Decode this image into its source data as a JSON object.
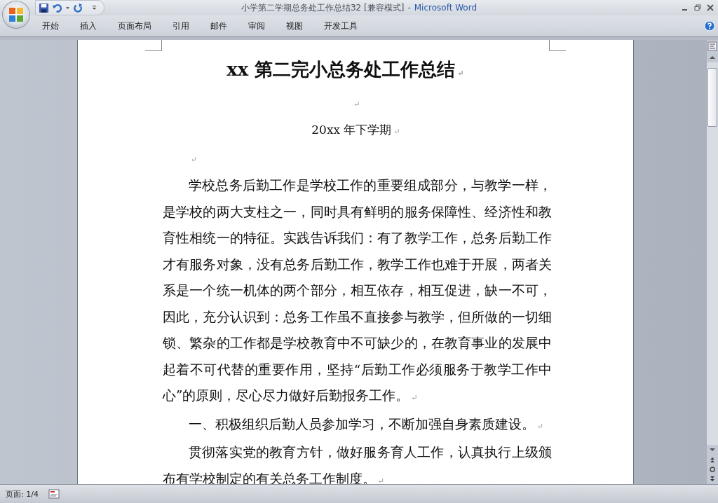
{
  "window": {
    "title": "小学第二学期总务处工作总结32 [兼容模式]",
    "separator": "-",
    "app_name": "Microsoft Word"
  },
  "tabs": [
    {
      "label": "开始"
    },
    {
      "label": "插入"
    },
    {
      "label": "页面布局"
    },
    {
      "label": "引用"
    },
    {
      "label": "邮件"
    },
    {
      "label": "审阅"
    },
    {
      "label": "视图"
    },
    {
      "label": "开发工具"
    }
  ],
  "document": {
    "paragraphs": [
      {
        "kind": "title",
        "text": "xx 第二完小总务处工作总结",
        "mark": "↵"
      },
      {
        "kind": "blank-center",
        "mark": "↵"
      },
      {
        "kind": "subtitle",
        "text": "20xx 年下学期",
        "mark": "↵"
      },
      {
        "kind": "blank",
        "mark": "↵"
      },
      {
        "kind": "body",
        "text": "学校总务后勤工作是学校工作的重要组成部分，与教学一样，是学校的两大支柱之一，同时具有鲜明的服务保障性、经济性和教育性相统一的特征。实践告诉我们：有了教学工作，总务后勤工作才有服务对象，没有总务后勤工作，教学工作也难于开展，两者关系是一个统一机体的两个部分，相互依存，相互促进，缺一不可，因此，充分认识到：总务工作虽不直接参与教学，但所做的一切细锁、繁杂的工作都是学校教育中不可缺少的，在教育事业的发展中起着不可代替的重要作用，坚持“后勤工作必须服务于教学工作中心”的原则，尽心尽力做好后勤报务工作。",
        "mark": "↵"
      },
      {
        "kind": "body",
        "text": "一、积极组织后勤人员参加学习，不断加强自身素质建设。",
        "mark": "↵"
      },
      {
        "kind": "body",
        "text": "贯彻落实党的教育方针，做好服务育人工作，认真执行上级颁布有学校制定的有关总务工作制度。",
        "mark": "↵"
      }
    ]
  },
  "status_bar": {
    "page": "页面: 1/4"
  }
}
